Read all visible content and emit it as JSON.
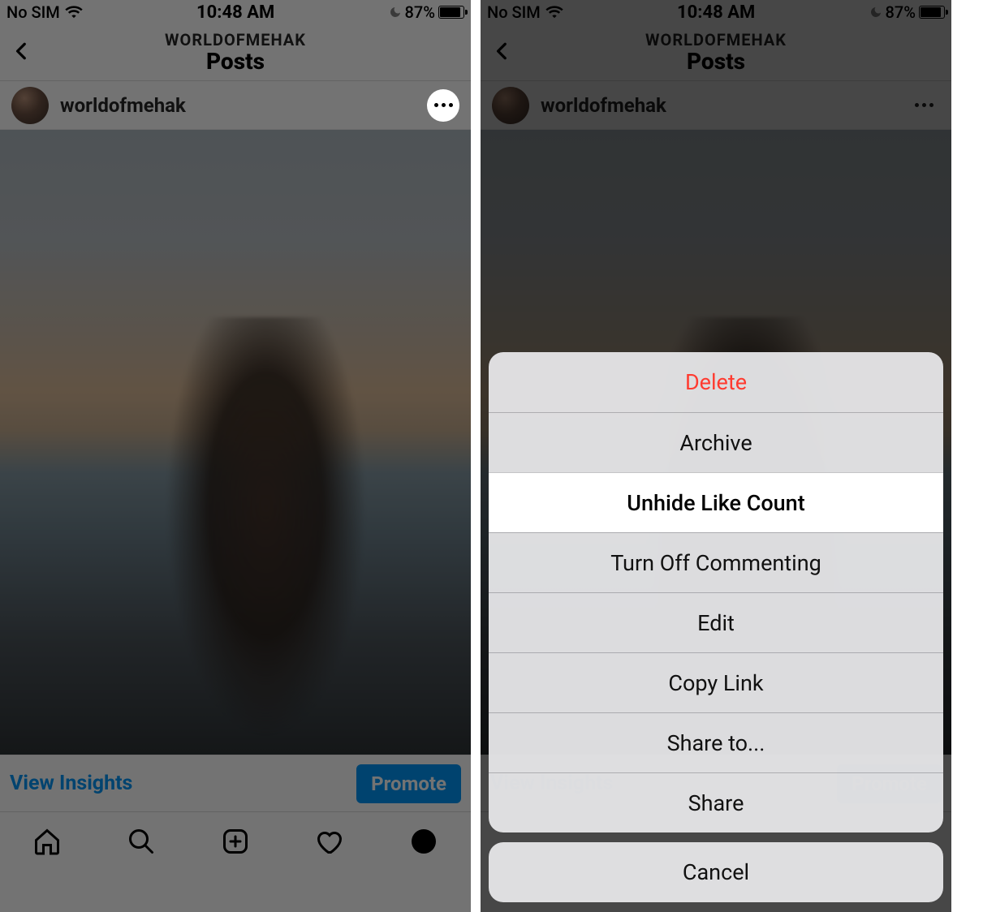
{
  "status_bar": {
    "carrier": "No SIM",
    "time": "10:48 AM",
    "battery_pct": "87%"
  },
  "header": {
    "subtitle": "WORLDOFMEHAK",
    "title": "Posts"
  },
  "post": {
    "username": "worldofmehak"
  },
  "insights": {
    "view_label": "View Insights",
    "promote_label": "Promote"
  },
  "action_sheet": {
    "items": [
      {
        "label": "Delete",
        "destructive": true
      },
      {
        "label": "Archive"
      },
      {
        "label": "Unhide Like Count",
        "highlighted": true
      },
      {
        "label": "Turn Off Commenting"
      },
      {
        "label": "Edit"
      },
      {
        "label": "Copy Link"
      },
      {
        "label": "Share to..."
      },
      {
        "label": "Share"
      }
    ],
    "cancel": "Cancel"
  }
}
